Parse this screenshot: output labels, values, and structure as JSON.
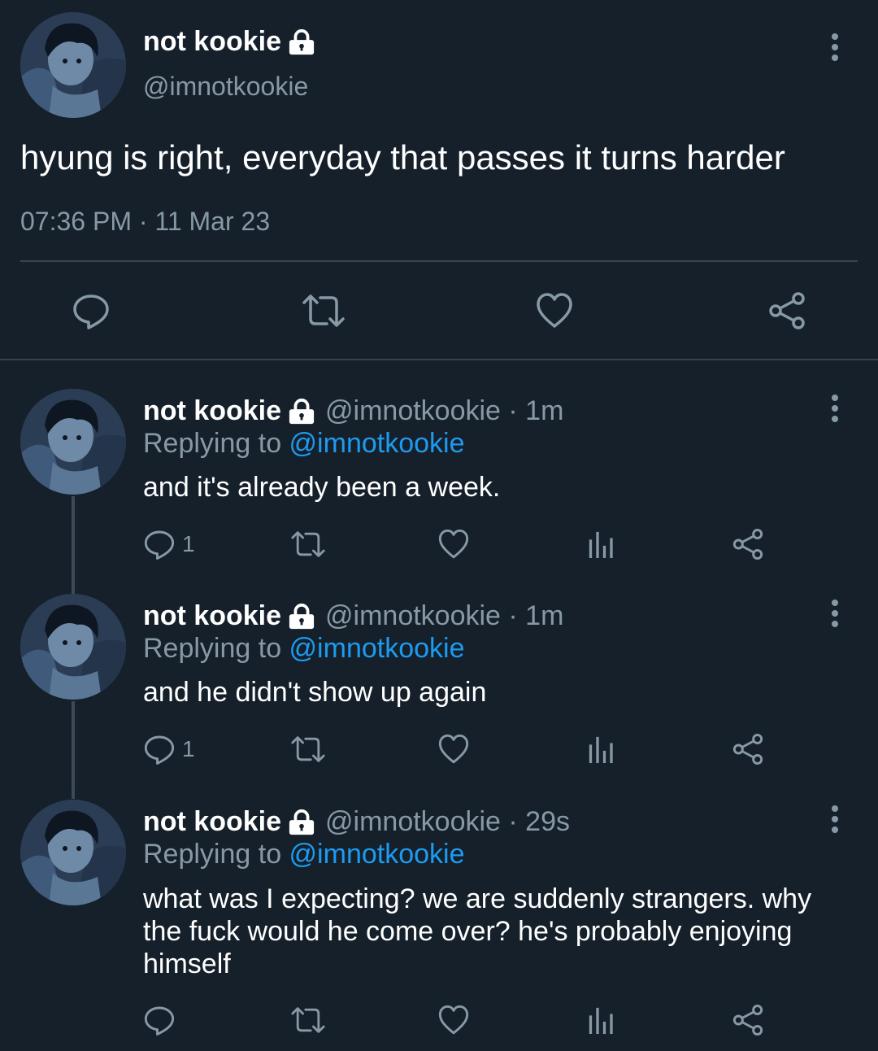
{
  "main_tweet": {
    "name": "not kookie",
    "handle": "@imnotkookie",
    "text": "hyung is right, everyday that passes it turns harder",
    "timestamp": "07:36 PM · 11 Mar 23",
    "icons": [
      "avatar",
      "lock-icon",
      "more-icon",
      "reply-icon",
      "retweet-icon",
      "like-icon",
      "share-icon"
    ]
  },
  "replies": [
    {
      "name": "not kookie",
      "meta": "@imnotkookie · 1m",
      "replying_prefix": "Replying to ",
      "replying_handle": "@imnotkookie",
      "text": "and it's already been a week.",
      "reply_count": "1"
    },
    {
      "name": "not kookie",
      "meta": "@imnotkookie · 1m",
      "replying_prefix": "Replying to ",
      "replying_handle": "@imnotkookie",
      "text": "and he didn't show up again",
      "reply_count": "1"
    },
    {
      "name": "not kookie",
      "meta": "@imnotkookie · 29s",
      "replying_prefix": "Replying to ",
      "replying_handle": "@imnotkookie",
      "text": "what was I expecting? we are suddenly strangers. why the fuck would he come over? he's probably enjoying himself",
      "reply_count": ""
    }
  ],
  "colors": {
    "background": "#15202b",
    "muted": "#8899a6",
    "link": "#1d9bf0",
    "divider": "#38444d"
  }
}
